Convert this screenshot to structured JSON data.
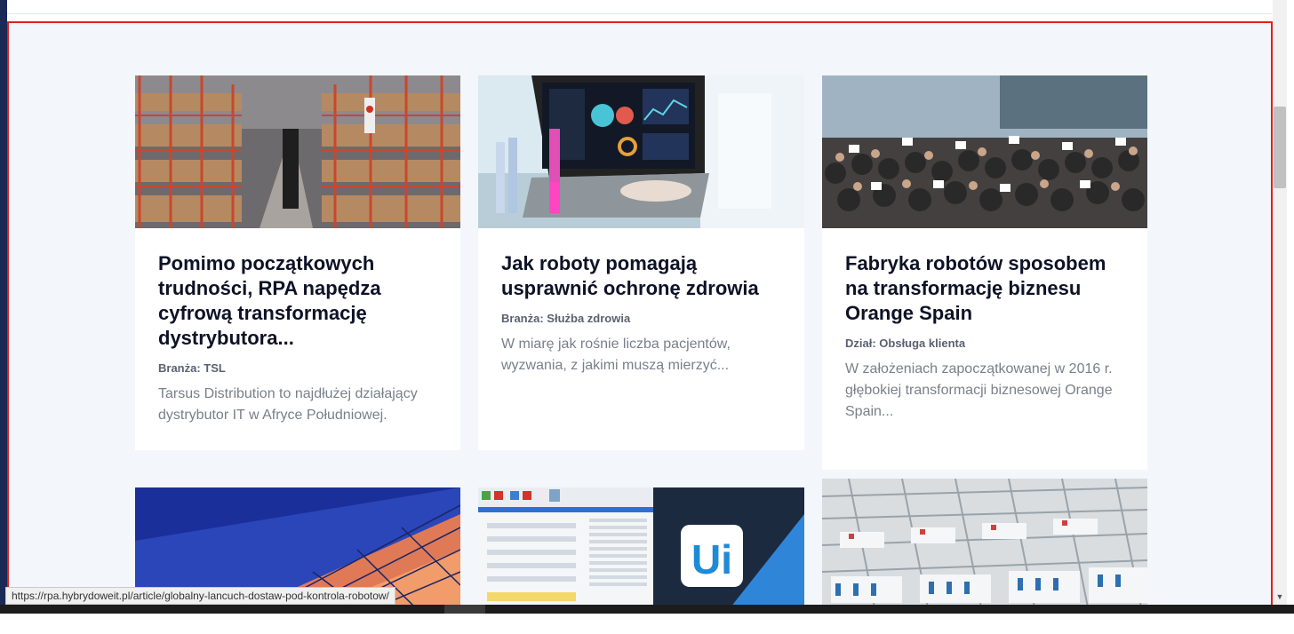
{
  "cards": [
    {
      "image_alt": "warehouse",
      "title": "Pomimo początkowych trudności, RPA napędza cyfrową transformację dystrybutora...",
      "meta": "Branża: TSL",
      "description": "Tarsus Distribution to najdłużej działający dystrybutor IT w Afryce Południowej."
    },
    {
      "image_alt": "laboratory laptop",
      "title": "Jak roboty pomagają usprawnić ochronę zdrowia",
      "meta": "Branża: Służba zdrowia",
      "description": "W miarę jak rośnie liczba pacjentów, wyzwania, z jakimi muszą mierzyć..."
    },
    {
      "image_alt": "team photo",
      "title": "Fabryka robotów sposobem na transformację biznesu Orange Spain",
      "meta": "Dział: Obsługa klienta",
      "description": "W założeniach zapoczątkowanej w 2016 r. głębokiej transformacji biznesowej Orange Spain..."
    }
  ],
  "second_row": [
    {
      "image_alt": "glass building"
    },
    {
      "image_alt": "UiPath studio",
      "logo_text": "Ui"
    },
    {
      "image_alt": "production line"
    }
  ],
  "status_url": "https://rpa.hybrydoweit.pl/article/globalny-lancuch-dostaw-pod-kontrola-robotow/",
  "colors": {
    "section_bg": "#f3f6fa",
    "highlight_border": "#e0201f",
    "title": "#0d1226",
    "uipath_blue": "#1f8ad6"
  }
}
